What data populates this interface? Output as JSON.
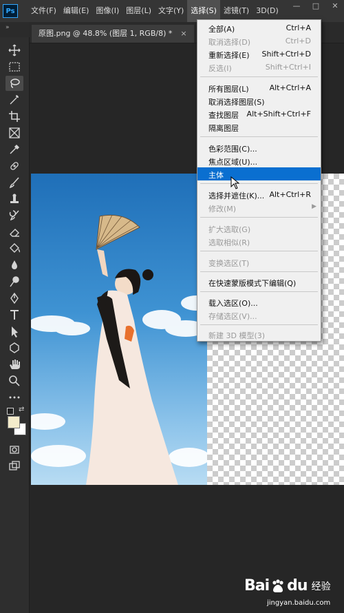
{
  "app": {
    "logo": "Ps"
  },
  "menubar": {
    "items": [
      "文件(F)",
      "编辑(E)",
      "图像(I)",
      "图层(L)",
      "文字(Y)",
      "选择(S)",
      "滤镜(T)",
      "3D(D)"
    ],
    "active_index": 5
  },
  "window_controls": {
    "minimize": "—",
    "restore": "□",
    "close": "✕"
  },
  "collapse_arrows": "»",
  "document_tab": {
    "title": "原图.png @ 48.8% (图层 1, RGB/8) *",
    "close": "×"
  },
  "select_menu": {
    "items": [
      {
        "label": "全部(A)",
        "shortcut": "Ctrl+A",
        "disabled": false
      },
      {
        "label": "取消选择(D)",
        "shortcut": "Ctrl+D",
        "disabled": true
      },
      {
        "label": "重新选择(E)",
        "shortcut": "Shift+Ctrl+D",
        "disabled": false
      },
      {
        "label": "反选(I)",
        "shortcut": "Shift+Ctrl+I",
        "disabled": true
      },
      {
        "label": "所有图层(L)",
        "shortcut": "Alt+Ctrl+A",
        "disabled": false
      },
      {
        "label": "取消选择图层(S)",
        "shortcut": "",
        "disabled": false
      },
      {
        "label": "查找图层",
        "shortcut": "Alt+Shift+Ctrl+F",
        "disabled": false
      },
      {
        "label": "隔离图层",
        "shortcut": "",
        "disabled": false
      },
      {
        "label": "色彩范围(C)...",
        "shortcut": "",
        "disabled": false
      },
      {
        "label": "焦点区域(U)...",
        "shortcut": "",
        "disabled": false
      },
      {
        "label": "主体",
        "shortcut": "",
        "disabled": false,
        "highlighted": true
      },
      {
        "label": "选择并遮住(K)...",
        "shortcut": "Alt+Ctrl+R",
        "disabled": false
      },
      {
        "label": "修改(M)",
        "shortcut": "",
        "disabled": true,
        "submenu": true
      },
      {
        "label": "扩大选取(G)",
        "shortcut": "",
        "disabled": true
      },
      {
        "label": "选取相似(R)",
        "shortcut": "",
        "disabled": true
      },
      {
        "label": "变换选区(T)",
        "shortcut": "",
        "disabled": true
      },
      {
        "label": "在快速蒙版模式下编辑(Q)",
        "shortcut": "",
        "disabled": false
      },
      {
        "label": "载入选区(O)...",
        "shortcut": "",
        "disabled": false
      },
      {
        "label": "存储选区(V)...",
        "shortcut": "",
        "disabled": true
      },
      {
        "label": "新建 3D 模型(3)",
        "shortcut": "",
        "disabled": true
      }
    ]
  },
  "tools": [
    "move",
    "marquee",
    "lasso",
    "quick-select",
    "crop",
    "frame",
    "eyedropper",
    "healing",
    "brush",
    "stamp",
    "history-brush",
    "eraser",
    "paint-bucket",
    "blur",
    "dodge",
    "pen",
    "type",
    "path-select",
    "shape",
    "hand",
    "zoom",
    "more"
  ],
  "colors": {
    "accent_highlight": "#0a6fd0",
    "foreground_swatch": "#f4eccb",
    "background_swatch": "#ffffff"
  },
  "watermark": {
    "brand_text": "Bai",
    "brand_text_2": "du",
    "brand_cn": "经验",
    "url": "jingyan.baidu.com"
  }
}
